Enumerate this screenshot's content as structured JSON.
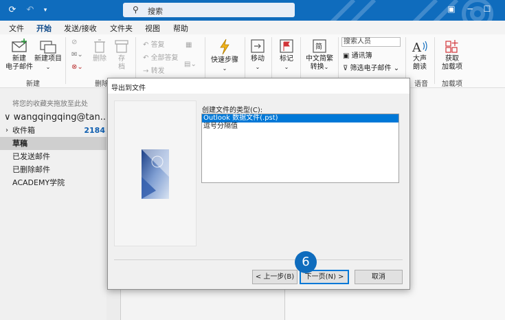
{
  "titlebar": {
    "search_placeholder": "搜索",
    "icons": [
      "sync-icon",
      "undo-icon",
      "customize-icon",
      "search-icon",
      "present-icon",
      "minimize-icon",
      "maximize-icon",
      "close-icon"
    ],
    "accent": "#0f6cbd"
  },
  "menu": [
    "文件",
    "开始",
    "发送/接收",
    "文件夹",
    "视图",
    "帮助"
  ],
  "menu_active": "开始",
  "ribbon": {
    "new_email": "新建\n电子邮件",
    "new_item": "新建项目",
    "group_new": "新建",
    "delete": "删除",
    "archive": "存\n档",
    "group_delete": "删除",
    "reply": "答复",
    "reply_all": "全部答复",
    "forward": "转发",
    "quick_steps": "快速步骤",
    "move": "移动",
    "tag": "标记",
    "convert": "中文简繁\n转换",
    "search_people": "搜索人员",
    "address_book": "通讯簿",
    "filter_email": "筛选电子邮件",
    "read_aloud": "大声\n朗读",
    "group_speech": "语音",
    "get_addins": "获取\n加载项",
    "group_addins": "加载项"
  },
  "folders": {
    "fav_hint": "将您的收藏夹拖放至此处",
    "account": "wangqingqing@tan...",
    "items": [
      {
        "label": "收件箱",
        "count": "2184",
        "selected": false,
        "expandable": true
      },
      {
        "label": "草稿",
        "count": "",
        "selected": true,
        "expandable": false
      },
      {
        "label": "已发送邮件",
        "count": "",
        "selected": false,
        "expandable": false
      },
      {
        "label": "已删除邮件",
        "count": "",
        "selected": false,
        "expandable": false
      },
      {
        "label": "ACADEMY学院",
        "count": "",
        "selected": false,
        "expandable": false
      }
    ]
  },
  "dialog": {
    "title": "导出到文件",
    "prompt": "创建文件的类型(C):",
    "options": [
      {
        "label": "Outlook 数据文件(.pst)",
        "selected": true
      },
      {
        "label": "逗号分隔值",
        "selected": false
      }
    ],
    "back": "< 上一步(B)",
    "next": "下一页(N) >",
    "cancel": "取消"
  },
  "step_badge": "6"
}
